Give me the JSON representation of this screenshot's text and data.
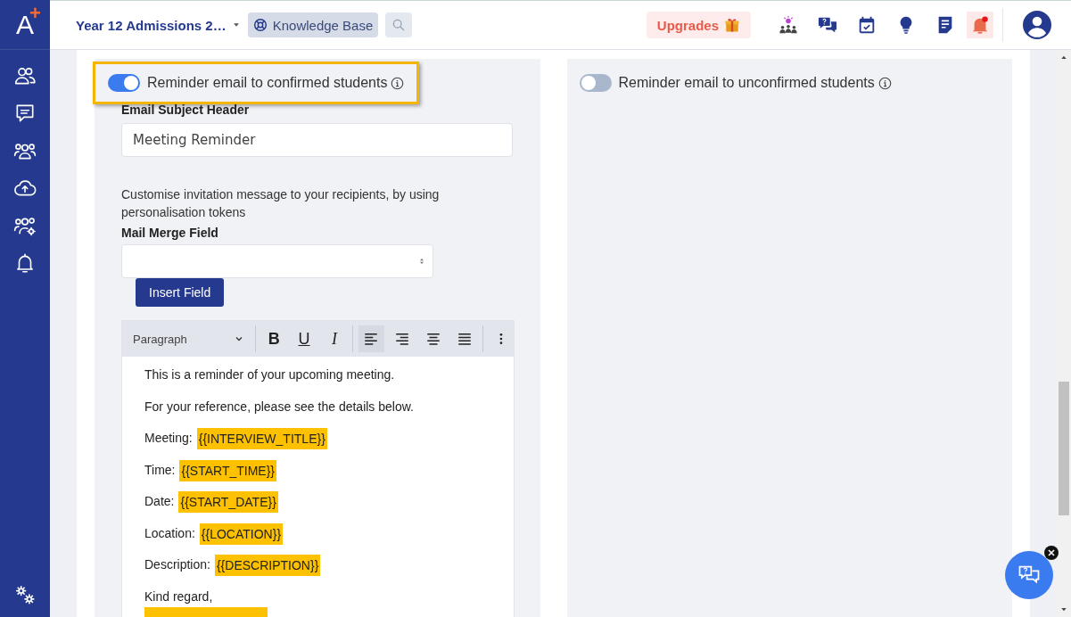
{
  "logo": {
    "letter": "A",
    "mark": "+"
  },
  "sidebar": {
    "items": [
      {
        "kind": "people"
      },
      {
        "kind": "chat"
      },
      {
        "kind": "group"
      },
      {
        "kind": "upload"
      },
      {
        "kind": "group-settings"
      },
      {
        "kind": "bell"
      }
    ],
    "footer": {
      "kind": "settings"
    }
  },
  "topbar": {
    "project": "Year 12 Admissions 2…",
    "knowledge_base": "Knowledge Base",
    "upgrades": "Upgrades",
    "icons": [
      {
        "kind": "event"
      },
      {
        "kind": "help-chat"
      },
      {
        "kind": "calendar"
      },
      {
        "kind": "bulb"
      },
      {
        "kind": "notes"
      },
      {
        "kind": "bell",
        "alert": true
      }
    ]
  },
  "left_panel": {
    "toggle": {
      "label": "Reminder email to confirmed students",
      "on": true,
      "highlighted": true
    },
    "subject_label": "Email Subject Header",
    "subject_value": "Meeting Reminder",
    "hint": "Customise invitation message to your recipients, by using personalisation tokens",
    "merge_label": "Mail Merge Field",
    "insert_button": "Insert Field",
    "editor": {
      "block_style": "Paragraph",
      "format": [
        {
          "kind": "bold",
          "glyph": "B"
        },
        {
          "kind": "underline",
          "glyph": "U"
        },
        {
          "kind": "italic",
          "glyph": "I"
        }
      ],
      "align": [
        {
          "kind": "left",
          "selected": true
        },
        {
          "kind": "right",
          "selected": false
        },
        {
          "kind": "center",
          "selected": false
        },
        {
          "kind": "justify",
          "selected": false
        }
      ],
      "lines": [
        {
          "kind": "text",
          "text": "This is a reminder of your upcoming meeting."
        },
        {
          "kind": "text",
          "text": "For your reference, please see the details below."
        },
        {
          "kind": "field",
          "text": "Meeting:",
          "token": "{{INTERVIEW_TITLE}}"
        },
        {
          "kind": "field",
          "text": "Time:",
          "token": "{{START_TIME}}"
        },
        {
          "kind": "field",
          "text": "Date:",
          "token": "{{START_DATE}}"
        },
        {
          "kind": "field",
          "text": "Location:",
          "token": "{{LOCATION}}"
        },
        {
          "kind": "field",
          "text": "Description:",
          "token": "{{DESCRIPTION}}"
        },
        {
          "kind": "text",
          "text": "Kind regard,"
        },
        {
          "kind": "cut-token"
        }
      ]
    }
  },
  "right_panel": {
    "toggle": {
      "label": "Reminder email to unconfirmed students",
      "on": false
    }
  }
}
